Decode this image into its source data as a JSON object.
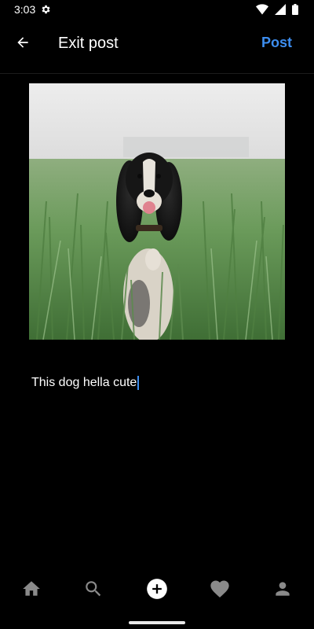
{
  "status_bar": {
    "time": "3:03",
    "icons": [
      "gear-icon",
      "wifi-icon",
      "cellular-signal-icon",
      "battery-icon"
    ]
  },
  "header": {
    "back_icon": "arrow-back-icon",
    "title": "Exit post",
    "post_label": "Post"
  },
  "post": {
    "image_subject": "spaniel dog in green wheat field",
    "caption": "This dog hella cute"
  },
  "bottom_nav": {
    "items": [
      {
        "icon": "home-icon"
      },
      {
        "icon": "search-icon"
      },
      {
        "icon": "add-circle-icon",
        "active": true
      },
      {
        "icon": "heart-icon"
      },
      {
        "icon": "person-icon"
      }
    ]
  },
  "colors": {
    "background": "#000000",
    "accent": "#3d8ef0",
    "inactive_icon": "#8a8a8a",
    "text": "#ffffff"
  }
}
